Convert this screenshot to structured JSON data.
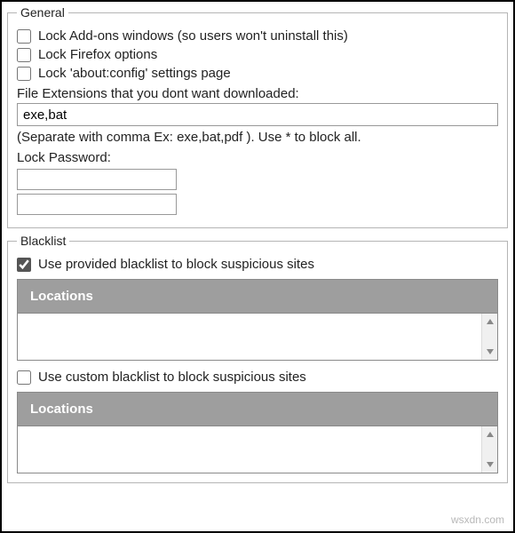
{
  "general": {
    "legend": "General",
    "lock_addons": {
      "label": "Lock Add-ons windows (so users won't uninstall this)",
      "checked": false
    },
    "lock_options": {
      "label": "Lock Firefox options",
      "checked": false
    },
    "lock_about_config": {
      "label": "Lock 'about:config' settings page",
      "checked": false
    },
    "extensions_label": "File Extensions that you dont want downloaded:",
    "extensions_value": "exe,bat",
    "extensions_hint": "(Separate with comma Ex: exe,bat,pdf ). Use * to block all.",
    "lock_password_label": "Lock Password:",
    "lock_password_value": "",
    "lock_password_confirm_value": ""
  },
  "blacklist": {
    "legend": "Blacklist",
    "provided": {
      "label": "Use provided blacklist to block suspicious sites",
      "checked": true
    },
    "custom": {
      "label": "Use custom blacklist to block suspicious sites",
      "checked": false
    },
    "locations_header": "Locations"
  },
  "watermark": "wsxdn.com"
}
